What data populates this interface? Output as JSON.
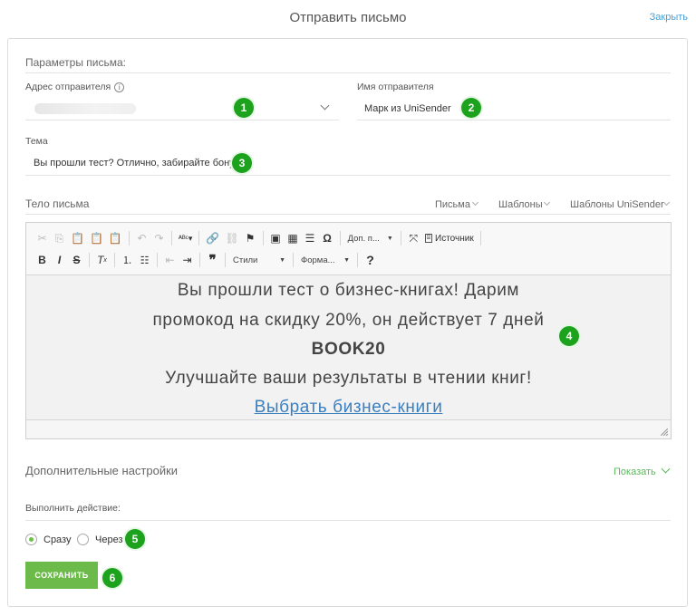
{
  "header": {
    "title": "Отправить письмо",
    "close_label": "Закрыть"
  },
  "params": {
    "section_label": "Параметры письма:",
    "sender_address_label": "Адрес отправителя",
    "sender_name_label": "Имя отправителя",
    "sender_name_value": "Марк из UniSender",
    "subject_label": "Тема",
    "subject_value": "Вы прошли тест? Отлично, забирайте бонус!"
  },
  "body_section": {
    "label": "Тело письма",
    "menus": [
      "Письма",
      "Шаблоны",
      "Шаблоны UniSender"
    ]
  },
  "toolbar": {
    "more_label": "Доп. п...",
    "source_label": "Источник",
    "styles_label": "Стили",
    "format_label": "Форма...",
    "help_label": "?"
  },
  "email_content": {
    "line1": "Вы прошли тест о бизнес-книгах! Дарим",
    "line2": "промокод на скидку 20%, он действует 7 дней",
    "code": "BOOK20",
    "line4": "Улучшайте ваши результаты в чтении книг!",
    "link": "Выбрать бизнес-книги"
  },
  "advanced": {
    "label": "Дополнительные настройки",
    "show_label": "Показать"
  },
  "action": {
    "label": "Выполнить действие:",
    "options": [
      "Сразу",
      "Через"
    ],
    "selected": "Сразу"
  },
  "save_label": "СОХРАНИТЬ",
  "badges": [
    "1",
    "2",
    "3",
    "4",
    "5",
    "6"
  ],
  "colors": {
    "accent_green": "#6cbb4a",
    "badge_green": "#1da21d",
    "link_blue": "#3a7fbf"
  }
}
